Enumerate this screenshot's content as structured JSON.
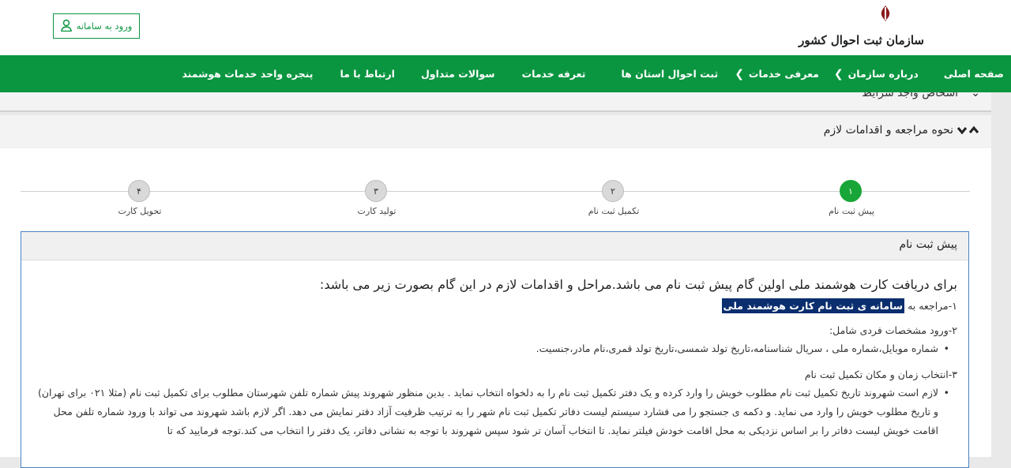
{
  "header": {
    "login_label": "ورود به سامانه",
    "logo_caption": "سازمان ثبت احوال کشور"
  },
  "nav": {
    "items": [
      {
        "label": "صفحه اصلی",
        "has_submenu": false
      },
      {
        "label": "درباره سازمان",
        "has_submenu": true
      },
      {
        "label": "معرفی خدمات",
        "has_submenu": true
      },
      {
        "label": "ثبت احوال استان ها",
        "has_submenu": false
      },
      {
        "label": "تعرفه خدمات",
        "has_submenu": false
      },
      {
        "label": "سوالات متداول",
        "has_submenu": false
      },
      {
        "label": "ارتباط با ما",
        "has_submenu": false
      },
      {
        "label": "پنجره واحد خدمات هوشمند",
        "has_submenu": false
      }
    ]
  },
  "accordions": {
    "eligible_title": "اشخاص واجد شرایط",
    "procedure_title": "نحوه مراجعه و اقدامات لازم"
  },
  "steps": [
    {
      "number": "۱",
      "label": "پیش ثبت نام",
      "active": true
    },
    {
      "number": "۲",
      "label": "تکمیل ثبت نام",
      "active": false
    },
    {
      "number": "۳",
      "label": "تولید کارت",
      "active": false
    },
    {
      "number": "۴",
      "label": "تحویل کارت",
      "active": false
    }
  ],
  "panel": {
    "title": "پیش ثبت نام",
    "intro": "برای دریافت کارت هوشمند ملی اولین گام پیش ثبت نام می باشد.مراحل و اقدامات لازم در این گام بصورت زیر می باشد:",
    "step1_prefix": "۱-مراجعه به",
    "step1_link": "سامانه ی ثبت نام کارت هوشمند ملی",
    "step2_title": "۲-ورود مشخصات فردی شامل:",
    "step2_bullet": "شماره موبایل،شماره ملی ، سریال شناسنامه،تاریخ تولد شمسی،تاریخ تولد قمری،نام مادر،جنسیت.",
    "step3_title": "۳-انتخاب زمان و مکان تکمیل ثبت نام",
    "step3_bullet": "لازم است شهروند تاریخ تکمیل ثبت نام مطلوب خویش را وارد کرده و یک دفتر تکمیل ثبت نام را به دلخواه انتخاب نماید . بدین منظور شهروند پیش شماره تلفن شهرستان مطلوب برای تکمیل ثبت نام (مثلا ۰۲۱ برای تهران) و تاریخ مطلوب خویش را وارد می نماید. و دکمه ی جستجو را می فشارد سیستم لیست دفاتر تکمیل ثبت نام شهر را به ترتیب ظرفیت آزاد دفتر نمایش می دهد. اگر لازم باشد شهروند می تواند با ورود شماره تلفن محل اقامت خویش لیست دفاتر را بر اساس نزدیکی به محل اقامت خودش فیلتر نماید. تا انتخاب آسان تر شود سپس شهروند با توجه به نشانی دفاتر، یک دفتر را انتخاب می کند.توجه فرمایید که تا"
  },
  "colors": {
    "brand_green": "#0a9640",
    "active_step": "#17a637",
    "highlight_bg": "#0a2e6e",
    "panel_border": "#4a84c4"
  }
}
